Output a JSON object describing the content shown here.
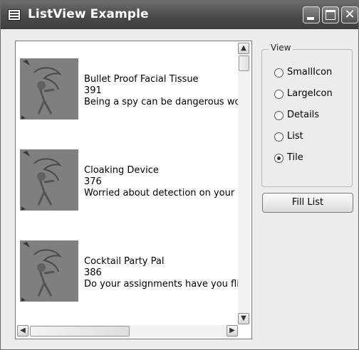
{
  "window": {
    "title": "ListView Example"
  },
  "list_items": [
    {
      "title": "Bullet Proof Facial Tissue",
      "id": "391",
      "description": "Being a spy can be dangerous work"
    },
    {
      "title": "Cloaking Device",
      "id": "376",
      "description": "Worried about detection on your cc"
    },
    {
      "title": "Cocktail Party Pal",
      "id": "386",
      "description": "Do your assignments have you flitti"
    }
  ],
  "view_group": {
    "label": "View",
    "options": [
      {
        "label": "SmallIcon",
        "selected": false
      },
      {
        "label": "LargeIcon",
        "selected": false
      },
      {
        "label": "Details",
        "selected": false
      },
      {
        "label": "List",
        "selected": false
      },
      {
        "label": "Tile",
        "selected": true
      }
    ]
  },
  "buttons": {
    "fill_list": "Fill List"
  },
  "icons": [
    "app-icon",
    "minimize-icon",
    "maximize-icon",
    "close-icon",
    "scroll-up-icon",
    "scroll-down-icon",
    "scroll-left-icon",
    "scroll-right-icon"
  ]
}
